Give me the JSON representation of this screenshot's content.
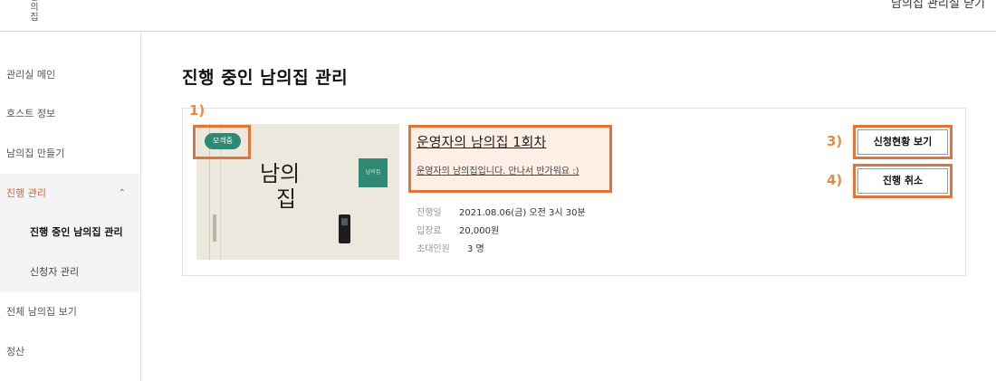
{
  "header": {
    "logo_chars": [
      "남",
      "의",
      "집"
    ],
    "close_label": "남의집 관리실 닫기"
  },
  "sidebar": {
    "items": [
      {
        "label": "관리실 메인"
      },
      {
        "label": "호스트 정보"
      },
      {
        "label": "남의집 만들기"
      },
      {
        "label": "진행 관리",
        "expanded": true,
        "chevron_icon": "chevron-up-icon"
      },
      {
        "label": "진행 중인 남의집 관리"
      },
      {
        "label": "신청자 관리"
      },
      {
        "label": "전체 남의집 보기"
      },
      {
        "label": "정산"
      }
    ]
  },
  "main": {
    "page_title": "진행 중인 남의집 관리",
    "event": {
      "status_badge": "모객중",
      "thumb_text_1": "남의",
      "thumb_text_2": "집",
      "thumb_tile_text": "남의집",
      "title": "운영자의 남의집 1회차",
      "description": "운영자의 남의집입니다. 만나서 반가워요 :)",
      "date_label": "진행일",
      "date_value": "2021.08.06(금) 오전 3시 30분",
      "fee_label": "입장료",
      "fee_value": "20,000원",
      "invite_label": "초대인원",
      "invite_value": "3 명"
    },
    "buttons": {
      "applications_label": "신청현황 보기",
      "cancel_label": "진행 취소"
    },
    "annotations": [
      "1)",
      "3)",
      "4)"
    ]
  },
  "colors": {
    "accent": "#e85b2d",
    "annotation_orange": "#e07439",
    "badge_green": "#2e8a72"
  }
}
